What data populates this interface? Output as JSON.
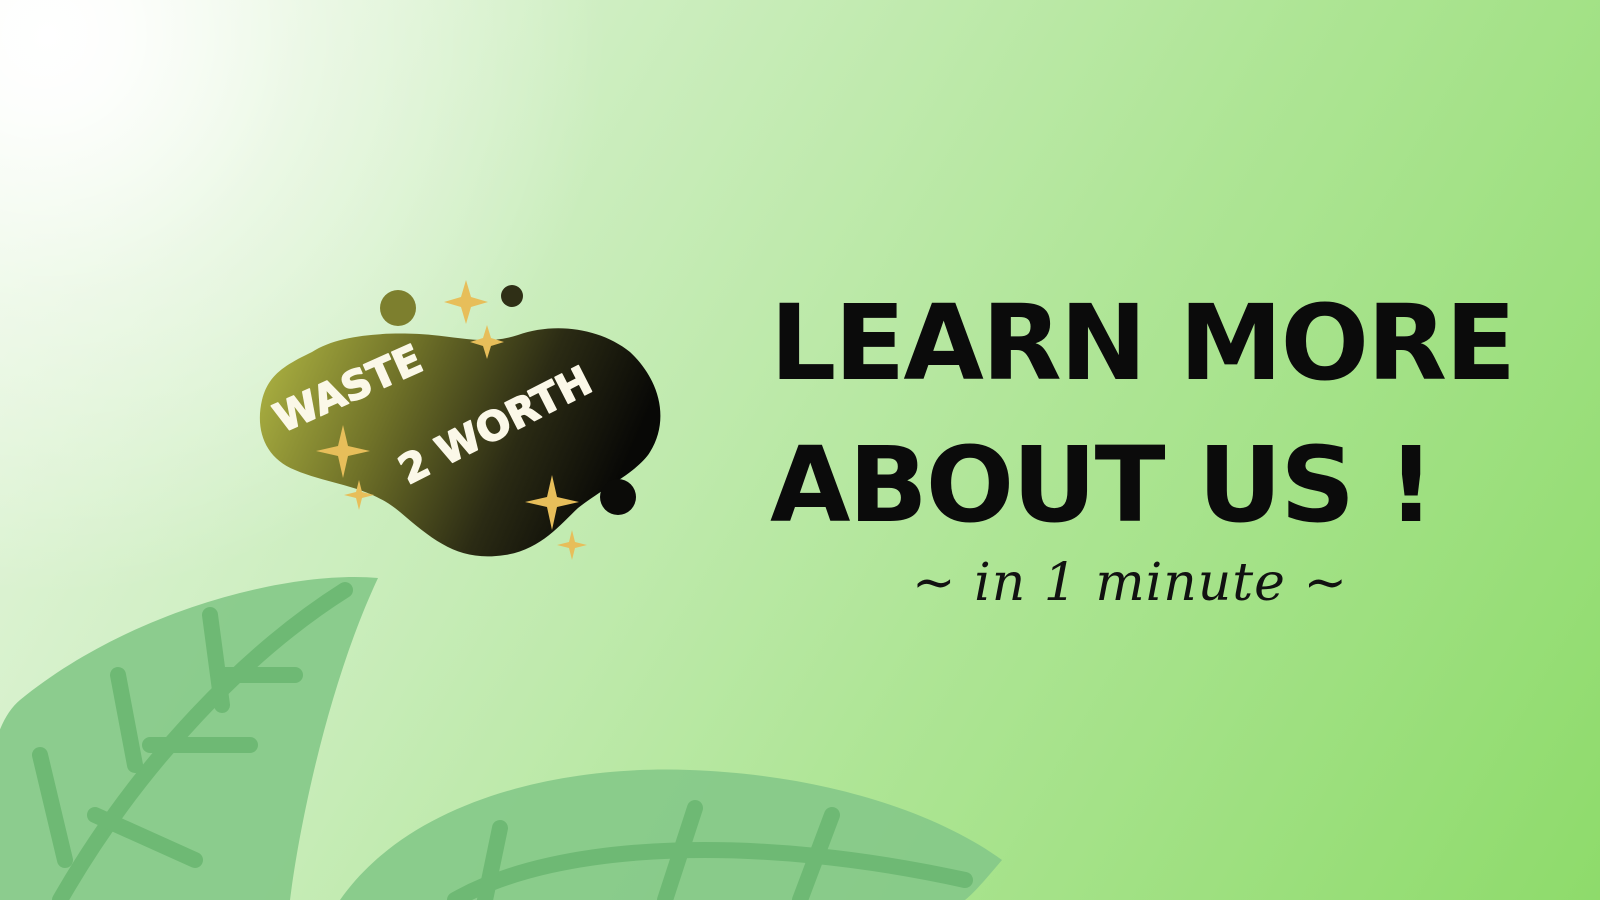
{
  "logo": {
    "line1": "WASTE",
    "line2": "2 WORTH"
  },
  "headline": {
    "line1": "LEARN MORE",
    "line2": "ABOUT US !"
  },
  "subheadline": "~ in 1 minute ~",
  "colors": {
    "background_light": "#eaf7e3",
    "background_green": "#8edb6b",
    "leaf": "#83c986",
    "leaf_vein": "#6fba75",
    "logo_dark": "#0c0c08",
    "logo_olive": "#a9b03f",
    "sparkle": "#e7be5a",
    "text": "#0b0b0b"
  }
}
